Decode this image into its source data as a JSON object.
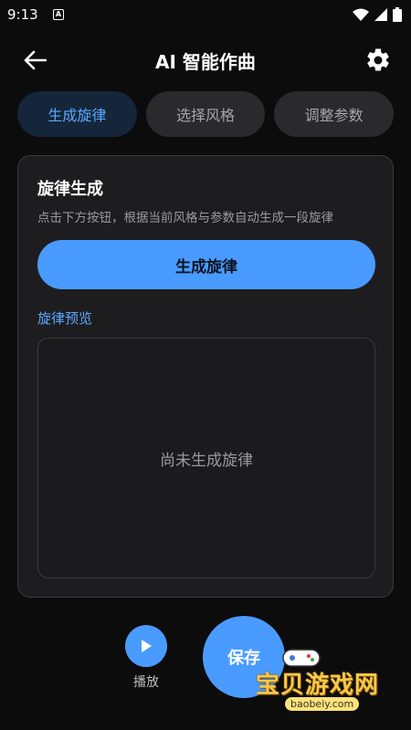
{
  "status_bar": {
    "time": "9:13",
    "app_icon_letter": "A"
  },
  "header": {
    "title": "AI 智能作曲"
  },
  "tabs": [
    {
      "label": "生成旋律",
      "active": true
    },
    {
      "label": "选择风格",
      "active": false
    },
    {
      "label": "调整参数",
      "active": false
    }
  ],
  "card": {
    "title": "旋律生成",
    "description": "点击下方按钮，根据当前风格与参数自动生成一段旋律",
    "generate_button": "生成旋律",
    "preview_label": "旋律预览",
    "preview_empty": "尚未生成旋律"
  },
  "bottom": {
    "play_label": "播放",
    "save_label": "保存"
  },
  "watermark": {
    "text": "宝贝游戏网",
    "url": "baobeiy.com"
  },
  "colors": {
    "accent": "#4a9bff",
    "background": "#0c0c0d",
    "card": "#1d1d1f"
  },
  "icons": {
    "back": "arrow-left-icon",
    "settings": "gear-icon",
    "play": "play-icon"
  }
}
